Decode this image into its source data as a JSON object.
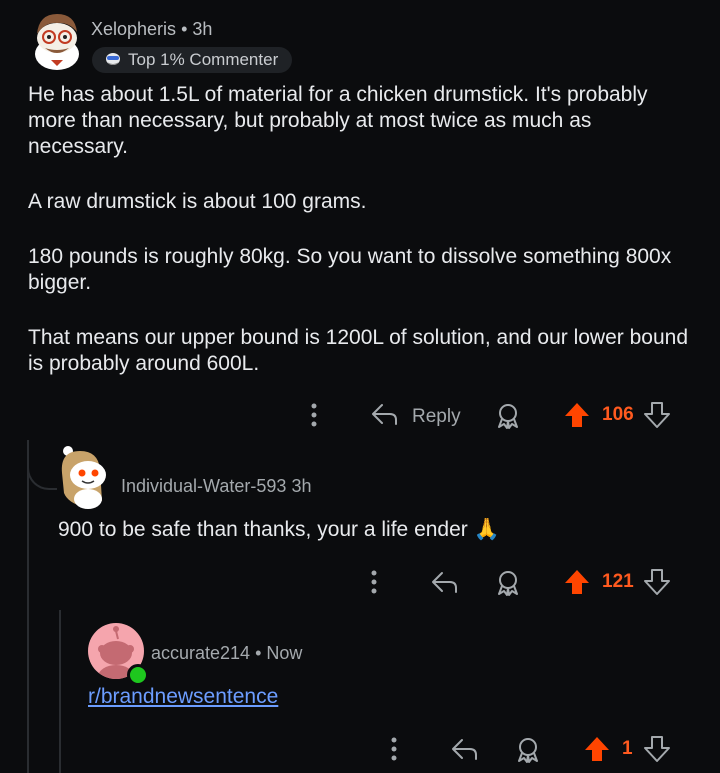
{
  "comments": [
    {
      "username": "Xelopheris",
      "time": "3h",
      "badge": "Top 1% Commenter",
      "paragraphs": [
        "He has about 1.5L of material for a chicken drumstick. It's probably more than necessary, but probably at most twice as much as necessary.",
        "A raw drumstick is about 100 grams.",
        "180 pounds is roughly 80kg. So you want to dissolve something 800x bigger.",
        "That means our upper bound is 1200L of solution, and our lower bound is probably around 600L."
      ],
      "reply_label": "Reply",
      "votes": "106"
    },
    {
      "username": "Individual-Water-593",
      "time": "3h",
      "text": "900 to be safe than thanks, your a life ender",
      "emoji": "🙏",
      "votes": "121"
    },
    {
      "username": "accurate214",
      "time": "Now",
      "link_text": "r/brandnewsentence",
      "votes": "1"
    }
  ],
  "colors": {
    "upvote": "#ff4500",
    "link": "#6c9dff",
    "online": "#1ec71e"
  },
  "icons": [
    "more-icon",
    "reply-icon",
    "award-icon",
    "upvote-icon",
    "downvote-icon",
    "pilot-icon",
    "pray-emoji"
  ]
}
